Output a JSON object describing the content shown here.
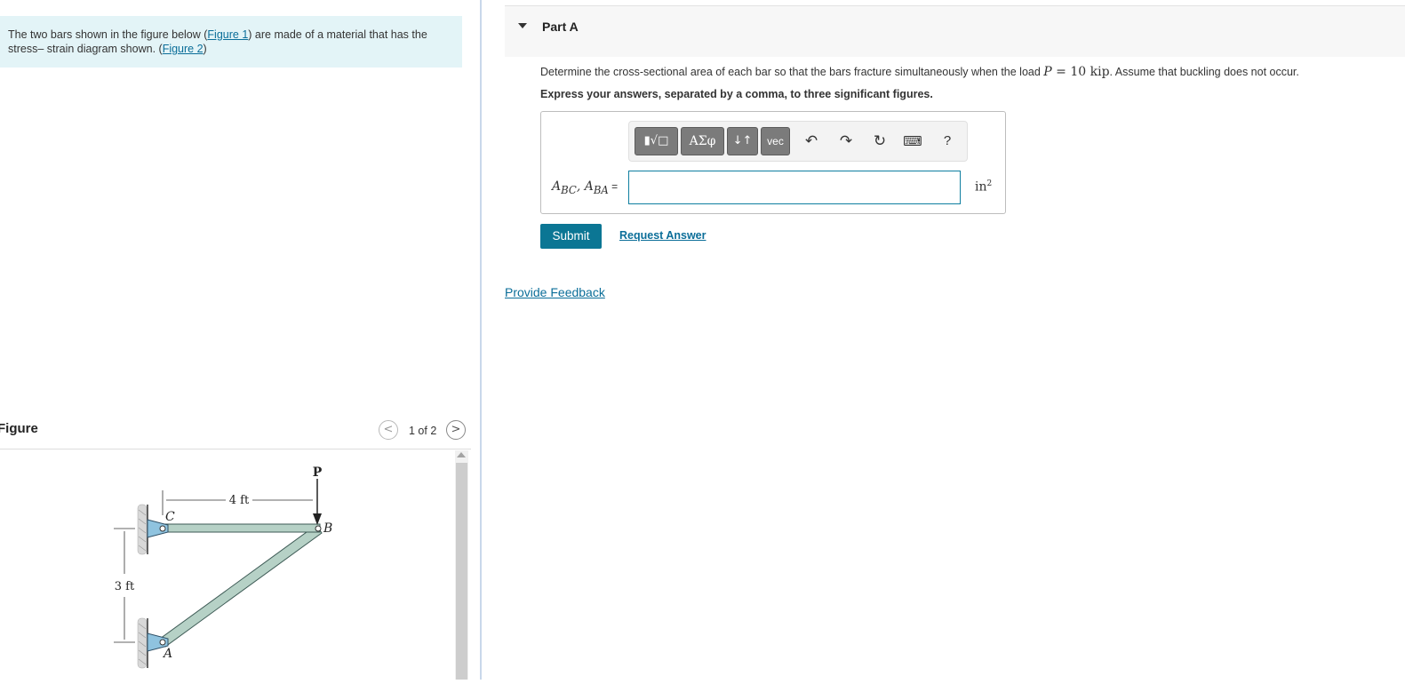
{
  "intro": {
    "text_before": "The two bars shown in the figure below (",
    "figure1_link": "Figure 1",
    "text_middle": ") are made of a material that has the stress– strain diagram shown. (",
    "figure2_link": "Figure 2",
    "text_after": ")"
  },
  "figure_panel": {
    "title": "Figure",
    "prev_icon": "<",
    "next_icon": ">",
    "page_count": "1 of 2",
    "diagram": {
      "load_label": "P",
      "width_dim": "4 ft",
      "height_dim": "3 ft",
      "joint_c": "C",
      "joint_b": "B",
      "joint_a": "A"
    }
  },
  "part": {
    "title": "Part A",
    "question_before": "Determine the cross-sectional area of each bar so that the bars fracture simultaneously when the load ",
    "load_symbol": "P",
    "load_value": " = 10 ",
    "load_unit": "kip",
    "question_after": ". Assume that buckling does not occur.",
    "instruction": "Express your answers, separated by a comma, to three significant figures."
  },
  "toolbar": {
    "templates_label": "▮√□",
    "greek_label": "ΑΣφ",
    "arrows_label": "↓↑",
    "vec_label": "vec",
    "undo_icon": "↶",
    "redo_icon": "↷",
    "reset_icon": "↻",
    "keyboard_icon": "⌨",
    "help_label": "?"
  },
  "answer": {
    "label_prefix": "A",
    "sub1": "BC",
    "sep": ", A",
    "sub2": "BA",
    "equals": " =",
    "value": "",
    "unit": "in",
    "unit_exp": "2"
  },
  "actions": {
    "submit_label": "Submit",
    "request_label": "Request Answer",
    "feedback_label": "Provide Feedback"
  },
  "colors": {
    "accent": "#0b7694",
    "intro_bg": "#e3f4f7",
    "bar_fill": "#b6d1c6",
    "support_fill": "#8fc3df"
  }
}
